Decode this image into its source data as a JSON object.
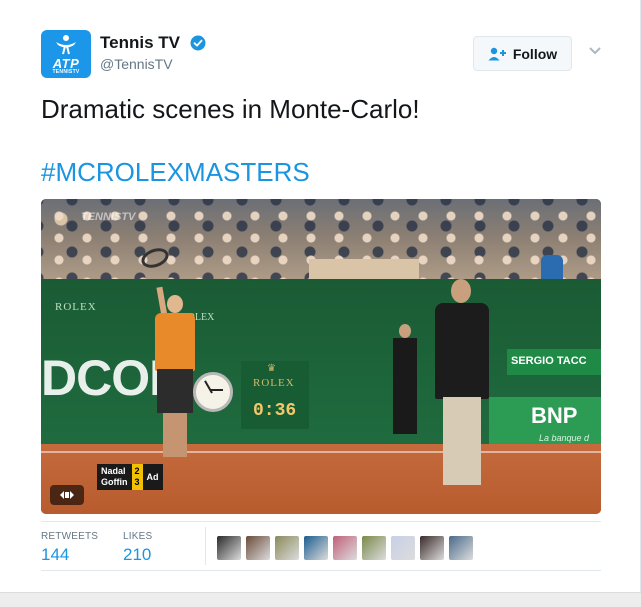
{
  "account": {
    "name": "Tennis TV",
    "handle": "@TennisTV",
    "avatar_text": "ATP",
    "avatar_subtext": "TENNISTV"
  },
  "follow_label": "Follow",
  "tweet": {
    "text": "Dramatic scenes in Monte-Carlo!",
    "hashtag": "#MCROLEXMASTERS"
  },
  "media": {
    "wall_text": "DCOM",
    "rolex_label": "ROLEX",
    "timer": "0:36",
    "sponsor_top": "SERGIO TACC",
    "sponsor_bnp": "BNP",
    "sponsor_bnp_sub": "La banque d",
    "watermark": "TENNISTV",
    "score": {
      "player1": "Nadal",
      "player2": "Goffin",
      "sets1": "2",
      "sets2": "3",
      "points": "Ad"
    }
  },
  "stats": {
    "retweets_label": "RETWEETS",
    "retweets": "144",
    "likes_label": "LIKES",
    "likes": "210"
  },
  "likers": [
    {
      "color": "#2a2a2a"
    },
    {
      "color": "#6b4a3a"
    },
    {
      "color": "#8a8a5a"
    },
    {
      "color": "#1b5d8f"
    },
    {
      "color": "#c0607a"
    },
    {
      "color": "#7a8a4a"
    },
    {
      "color": "#c8d0e8"
    },
    {
      "color": "#3a2a2a"
    },
    {
      "color": "#4a6a8a"
    }
  ],
  "colors": {
    "brand_blue": "#1b95e0",
    "avatar_blue": "#1b96e8"
  }
}
